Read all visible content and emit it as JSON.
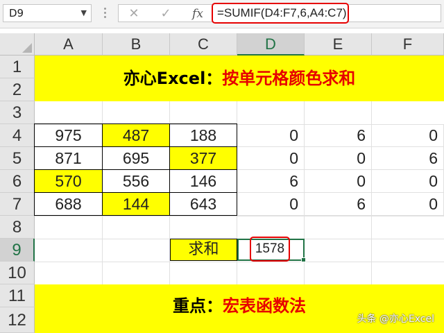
{
  "formula_bar": {
    "name_box": "D9",
    "cancel_icon": "✕",
    "enter_icon": "✓",
    "fx_label": "fx",
    "formula": "=SUMIF(D4:F7,6,A4:C7)"
  },
  "columns": [
    "A",
    "B",
    "C",
    "D",
    "E",
    "F"
  ],
  "rows": [
    "1",
    "2",
    "3",
    "4",
    "5",
    "6",
    "7",
    "8",
    "9",
    "10",
    "11",
    "12"
  ],
  "selected_cell": "D9",
  "title_banner": {
    "bold_part": "亦心Excel：",
    "red_part": "按单元格颜色求和"
  },
  "data_table": [
    [
      "975",
      "487",
      "188"
    ],
    [
      "871",
      "695",
      "377"
    ],
    [
      "570",
      "556",
      "146"
    ],
    [
      "688",
      "144",
      "643"
    ]
  ],
  "helper_table": [
    [
      "0",
      "6",
      "0"
    ],
    [
      "0",
      "0",
      "6"
    ],
    [
      "6",
      "0",
      "0"
    ],
    [
      "0",
      "6",
      "0"
    ]
  ],
  "sum_label": "求和",
  "sum_value": "1578",
  "bottom_banner": {
    "bold_part": "重点：",
    "red_part": "宏表函数法"
  },
  "watermark": "头条 @亦心Excel",
  "highlight_color": "#ffff00",
  "accent_red": "#e60000",
  "excel_green": "#217346"
}
